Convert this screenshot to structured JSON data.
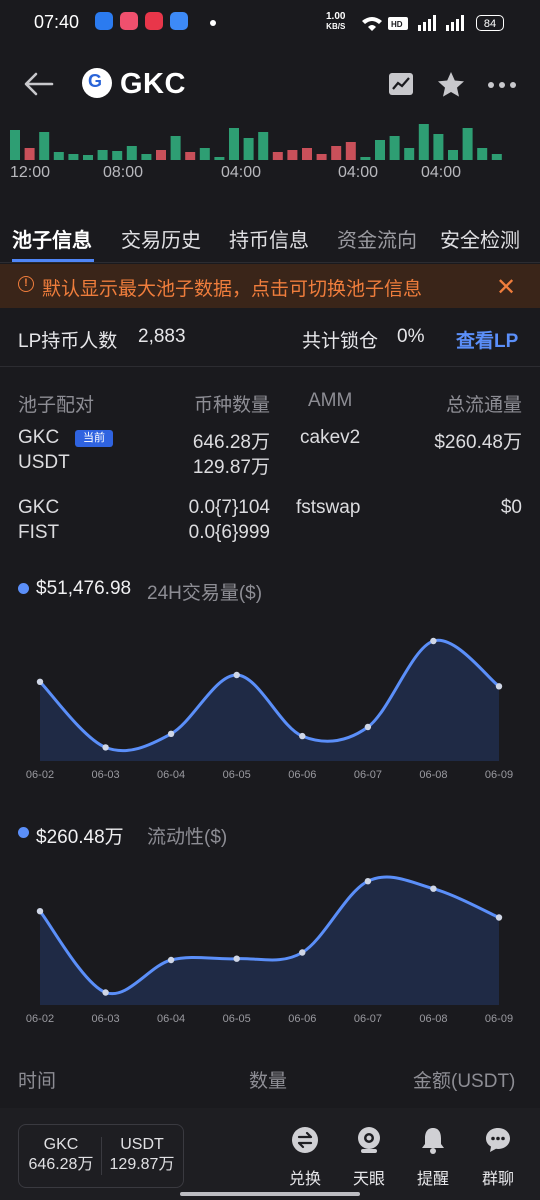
{
  "status_bar": {
    "time": "07:40",
    "net_speed_value": "1.00",
    "net_speed_unit": "KB/S",
    "battery": "84"
  },
  "header": {
    "title": "GKC",
    "logo_letter": "G"
  },
  "mini_chart": {
    "x_labels": [
      "12:00",
      "08:00",
      "04:00",
      "04:00",
      "04:00"
    ],
    "bars": [
      {
        "v": 30,
        "c": "g"
      },
      {
        "v": 12,
        "c": "r"
      },
      {
        "v": 28,
        "c": "g"
      },
      {
        "v": 8,
        "c": "g"
      },
      {
        "v": 6,
        "c": "g"
      },
      {
        "v": 5,
        "c": "g"
      },
      {
        "v": 10,
        "c": "g"
      },
      {
        "v": 9,
        "c": "g"
      },
      {
        "v": 14,
        "c": "g"
      },
      {
        "v": 6,
        "c": "g"
      },
      {
        "v": 10,
        "c": "r"
      },
      {
        "v": 24,
        "c": "g"
      },
      {
        "v": 8,
        "c": "r"
      },
      {
        "v": 12,
        "c": "g"
      },
      {
        "v": 3,
        "c": "g"
      },
      {
        "v": 32,
        "c": "g"
      },
      {
        "v": 22,
        "c": "g"
      },
      {
        "v": 28,
        "c": "g"
      },
      {
        "v": 8,
        "c": "r"
      },
      {
        "v": 10,
        "c": "r"
      },
      {
        "v": 12,
        "c": "r"
      },
      {
        "v": 6,
        "c": "r"
      },
      {
        "v": 14,
        "c": "r"
      },
      {
        "v": 18,
        "c": "r"
      },
      {
        "v": 3,
        "c": "g"
      },
      {
        "v": 20,
        "c": "g"
      },
      {
        "v": 24,
        "c": "g"
      },
      {
        "v": 12,
        "c": "g"
      },
      {
        "v": 36,
        "c": "g"
      },
      {
        "v": 26,
        "c": "g"
      },
      {
        "v": 10,
        "c": "g"
      },
      {
        "v": 32,
        "c": "g"
      },
      {
        "v": 12,
        "c": "g"
      },
      {
        "v": 6,
        "c": "g"
      }
    ],
    "colors": {
      "up": "#2e9e73",
      "down": "#c9505a"
    }
  },
  "tabs": [
    "池子信息",
    "交易历史",
    "持币信息",
    "资金流向",
    "安全检测"
  ],
  "notice": {
    "text": "默认显示最大池子数据，点击可切换池子信息"
  },
  "lp": {
    "holders_label": "LP持币人数",
    "holders_value": "2,883",
    "locked_label": "共计锁仓",
    "locked_value": "0%",
    "view_link": "查看LP"
  },
  "pool_table": {
    "headers": [
      "池子配对",
      "币种数量",
      "AMM",
      "总流通量"
    ],
    "rows": [
      {
        "token_a": "GKC",
        "token_b": "USDT",
        "badge": "当前",
        "amount_a": "646.28万",
        "amount_b": "129.87万",
        "amm": "cakev2",
        "total": "$260.48万"
      },
      {
        "token_a": "GKC",
        "token_b": "FIST",
        "amount_a": "0.0{7}104",
        "amount_b": "0.0{6}999",
        "amm": "fstswap",
        "total": "$0"
      }
    ]
  },
  "volume_chart": {
    "value": "$51,476.98",
    "label": "24H交易量($)"
  },
  "liquidity_chart": {
    "value": "$260.48万",
    "label": "流动性($)"
  },
  "chart_data": [
    {
      "type": "area",
      "title": "24H交易量($)",
      "x": [
        "06-02",
        "06-03",
        "06-04",
        "06-05",
        "06-06",
        "06-07",
        "06-08",
        "06-09"
      ],
      "y": [
        70,
        12,
        24,
        76,
        22,
        30,
        106,
        66
      ]
    },
    {
      "type": "area",
      "title": "流动性($)",
      "x": [
        "06-02",
        "06-03",
        "06-04",
        "06-05",
        "06-06",
        "06-07",
        "06-08",
        "06-09"
      ],
      "y": [
        75,
        10,
        36,
        37,
        42,
        99,
        93,
        70
      ]
    }
  ],
  "list_headers": [
    "时间",
    "数量",
    "金额(USDT)"
  ],
  "bottom_bar": {
    "pair": [
      {
        "symbol": "GKC",
        "amount": "646.28万"
      },
      {
        "symbol": "USDT",
        "amount": "129.87万"
      }
    ],
    "actions": [
      "兑换",
      "天眼",
      "提醒",
      "群聊"
    ]
  }
}
